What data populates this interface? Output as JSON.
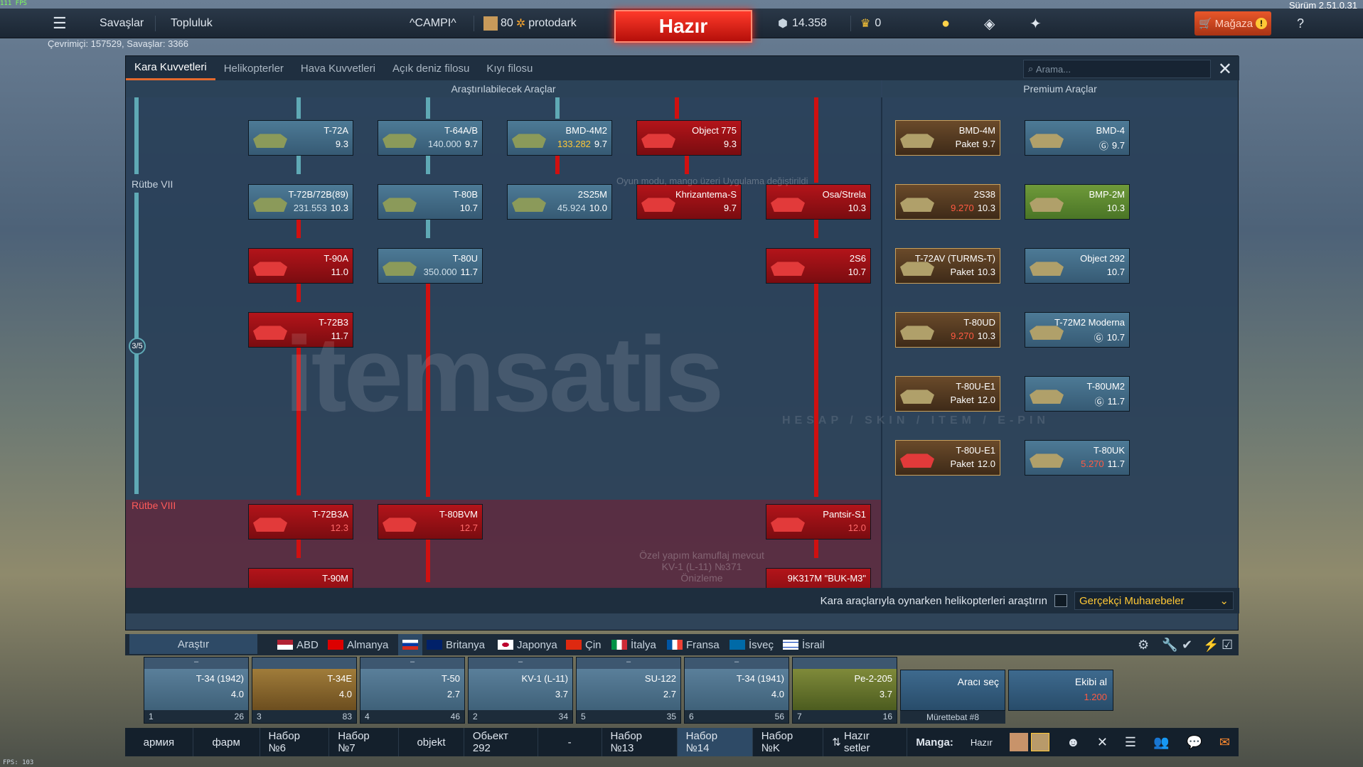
{
  "fps_top": "111 FPS",
  "fps_bottom": "FPS: 103",
  "version": "Sürüm 2.51.0.31",
  "topbar": {
    "battles": "Savaşlar",
    "community": "Topluluk",
    "squad_name": "^CAMPI^",
    "level": "80",
    "nickname": "protodark",
    "ready": "Hazır",
    "silver": "14.358",
    "gold": "0",
    "shop": "Mağaza"
  },
  "online": "Çevrimiçi: 157529, Savaşlar: 3366",
  "tabs": [
    "Kara Kuvvetleri",
    "Helikopterler",
    "Hava Kuvvetleri",
    "Açık deniz filosu",
    "Kıyı filosu"
  ],
  "search_placeholder": "Arama...",
  "headers": {
    "research": "Araştırılabilecek Araçlar",
    "premium": "Premium Araçlar"
  },
  "ranks": {
    "r7": "Rütbe VII",
    "r8": "Rütbe VIII",
    "progress": "3/5"
  },
  "vehicles": [
    {
      "id": "t72a",
      "name": "T-72A",
      "br": "9.3",
      "cost": ""
    },
    {
      "id": "t64",
      "name": "T-64A/B",
      "br": "9.7",
      "cost": "140.000"
    },
    {
      "id": "bmd4m2",
      "name": "BMD-4M2",
      "br": "9.7",
      "cost": "133.282"
    },
    {
      "id": "obj775",
      "name": "Object 775",
      "br": "9.3",
      "cost": ""
    },
    {
      "id": "t72b",
      "name": "T-72B/72B(89)",
      "br": "10.3",
      "cost": "231.553"
    },
    {
      "id": "t80b",
      "name": "T-80B",
      "br": "10.7",
      "cost": ""
    },
    {
      "id": "2s25m",
      "name": "2S25M",
      "br": "10.0",
      "cost": "45.924"
    },
    {
      "id": "khriz",
      "name": "Khrizantema-S",
      "br": "9.7",
      "cost": ""
    },
    {
      "id": "osa",
      "name": "Osa/Strela",
      "br": "10.3",
      "cost": ""
    },
    {
      "id": "t90a",
      "name": "T-90A",
      "br": "11.0",
      "cost": ""
    },
    {
      "id": "t80u",
      "name": "T-80U",
      "br": "11.7",
      "cost": "350.000"
    },
    {
      "id": "2s6",
      "name": "2S6",
      "br": "10.7",
      "cost": ""
    },
    {
      "id": "t72b3",
      "name": "T-72B3",
      "br": "11.7",
      "cost": ""
    },
    {
      "id": "t72b3a",
      "name": "T-72B3A",
      "br": "12.3",
      "cost": ""
    },
    {
      "id": "t80bvm",
      "name": "T-80BVM",
      "br": "12.7",
      "cost": ""
    },
    {
      "id": "pantsir",
      "name": "Pantsir-S1",
      "br": "12.0",
      "cost": ""
    },
    {
      "id": "t90m",
      "name": "T-90M",
      "br": "",
      "cost": ""
    },
    {
      "id": "buk",
      "name": "9K317M \"BUK-M3\"",
      "br": "",
      "cost": ""
    }
  ],
  "premium": [
    {
      "name": "BMD-4M",
      "br": "9.7",
      "cost": "Paket"
    },
    {
      "name": "BMD-4",
      "br": "9.7",
      "cost": ""
    },
    {
      "name": "2S38",
      "br": "10.3",
      "cost": "9.270"
    },
    {
      "name": "BMP-2M",
      "br": "10.3",
      "cost": ""
    },
    {
      "name": "T-72AV (TURMS-T)",
      "br": "10.3",
      "cost": "Paket"
    },
    {
      "name": "Object 292",
      "br": "10.7",
      "cost": ""
    },
    {
      "name": "T-80UD",
      "br": "10.3",
      "cost": "9.270"
    },
    {
      "name": "T-72M2 Moderna",
      "br": "10.7",
      "cost": ""
    },
    {
      "name": "T-80U-E1",
      "br": "12.0",
      "cost": "Paket"
    },
    {
      "name": "T-80UM2",
      "br": "11.7",
      "cost": ""
    },
    {
      "name": "T-80U-E1",
      "br": "12.0",
      "cost": "Paket"
    },
    {
      "name": "T-80UK",
      "br": "11.7",
      "cost": "5.270"
    }
  ],
  "overlay_text": {
    "line1": "Özel yapım kamuflaj mevcut",
    "line2": "KV-1 (L-11) №371",
    "line3": "Önizleme",
    "line4": "Oyun modu, mango üzeri Uygulama değiştirildi"
  },
  "bottomctrl": {
    "heli_label": "Kara araçlarıyla oynarken helikopterleri araştırın",
    "mode": "Gerçekçi Muharebeler"
  },
  "research_button": "Araştır",
  "nations": [
    "ABD",
    "Almanya",
    "",
    "Britanya",
    "Japonya",
    "Çin",
    "İtalya",
    "Fransa",
    "İsveç",
    "İsrail"
  ],
  "crew": [
    {
      "name": "T-34 (1942)",
      "br": "4.0",
      "n": "1",
      "pts": "26"
    },
    {
      "name": "T-34E",
      "br": "4.0",
      "n": "3",
      "pts": "83"
    },
    {
      "name": "T-50",
      "br": "2.7",
      "n": "4",
      "pts": "46"
    },
    {
      "name": "KV-1 (L-11)",
      "br": "3.7",
      "n": "2",
      "pts": "34"
    },
    {
      "name": "SU-122",
      "br": "2.7",
      "n": "5",
      "pts": "35"
    },
    {
      "name": "T-34 (1941)",
      "br": "4.0",
      "n": "6",
      "pts": "56"
    },
    {
      "name": "Pe-2-205",
      "br": "3.7",
      "n": "7",
      "pts": "16"
    }
  ],
  "crew_actions": {
    "select": "Aracı seç",
    "crew_label": "Mürettebat #8",
    "buy": "Ekibi al",
    "buy_cost": "1.200"
  },
  "presets": [
    "армия",
    "фарм",
    "Набор №6",
    "Набор №7",
    "objekt",
    "Обьект 292",
    "-",
    "Набор №13",
    "Набор №14",
    "Набор №K",
    "Hazır setler",
    "Manga:",
    "Hazır"
  ],
  "watermark": "itemsatis",
  "watermark_sub": "HESAP / SKIN / ITEM / E-PIN"
}
